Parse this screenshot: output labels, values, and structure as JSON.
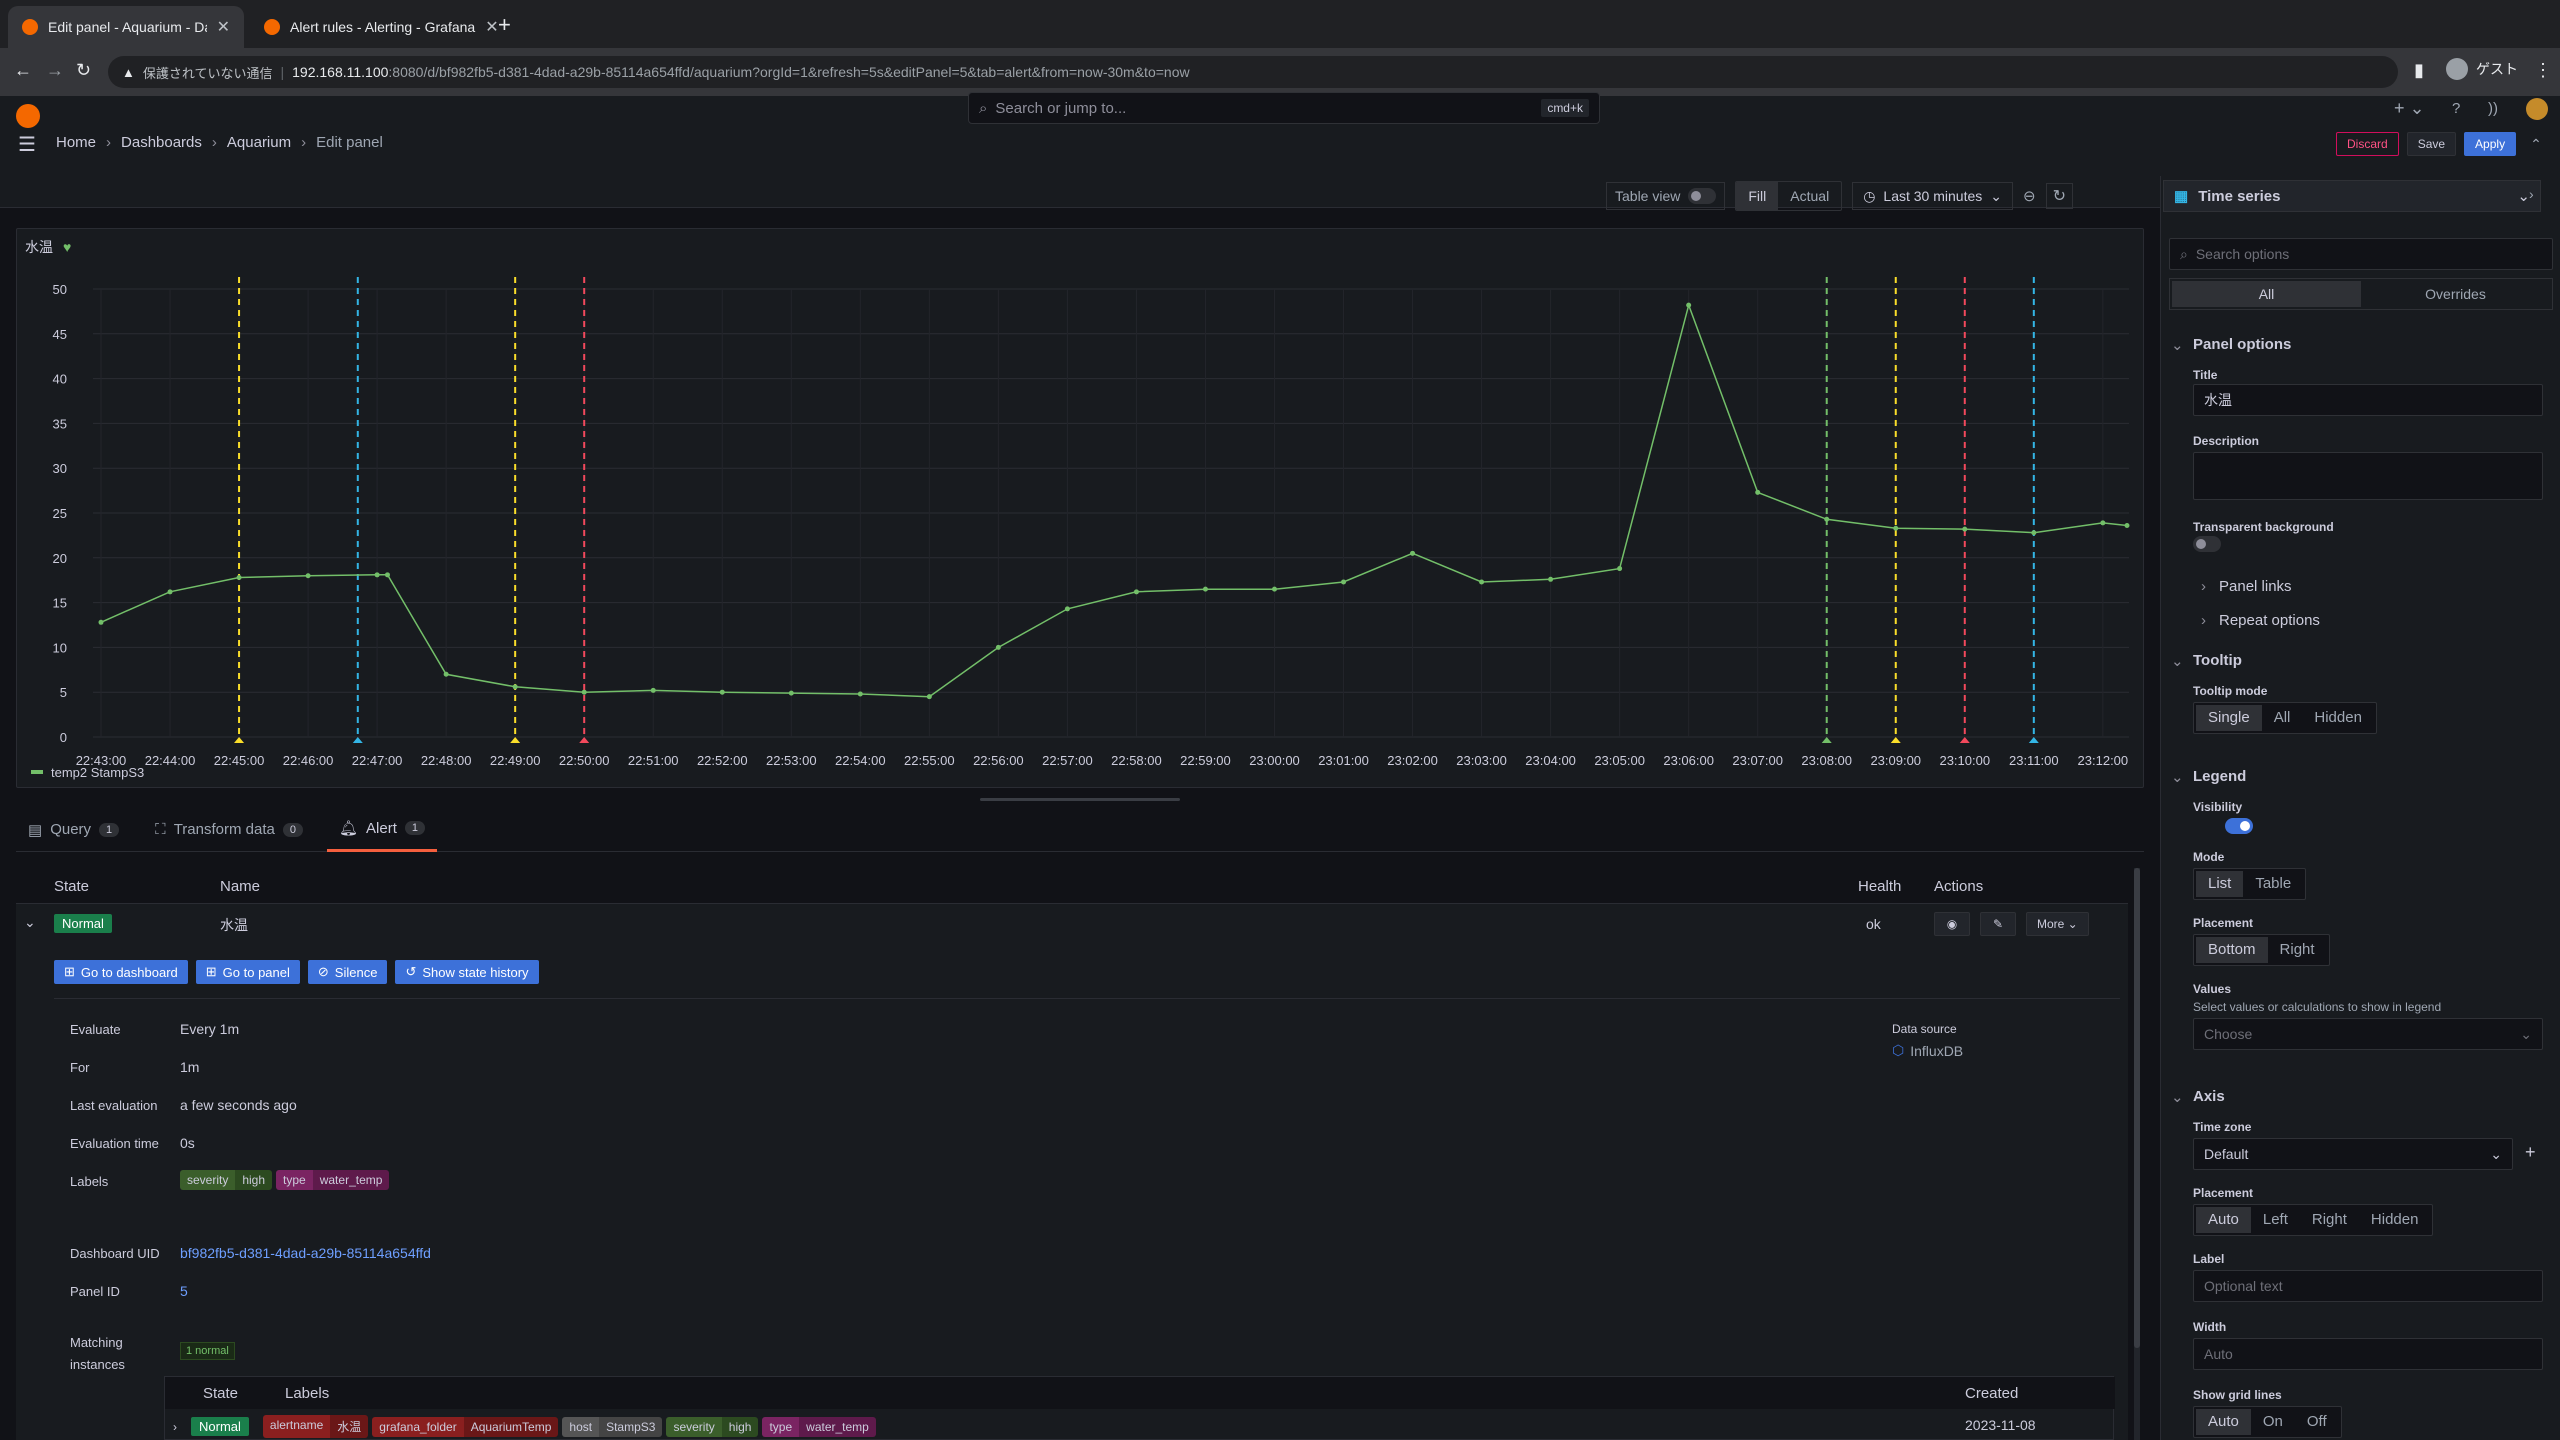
{
  "browser": {
    "tabs": [
      {
        "title": "Edit panel - Aquarium - Dashb",
        "active": true
      },
      {
        "title": "Alert rules - Alerting - Grafana",
        "active": false
      }
    ],
    "security": "保護されていない通信",
    "url_host": "192.168.11.100",
    "url_rest": ":8080/d/bf982fb5-d381-4dad-a29b-85114a654ffd/aquarium?orgId=1&refresh=5s&editPanel=5&tab=alert&from=now-30m&to=now",
    "profile": "ゲスト"
  },
  "header": {
    "search_placeholder": "Search or jump to...",
    "search_shortcut": "cmd+k",
    "breadcrumbs": [
      "Home",
      "Dashboards",
      "Aquarium",
      "Edit panel"
    ],
    "discard": "Discard",
    "save": "Save",
    "apply": "Apply"
  },
  "panel_toolbar": {
    "table_view": "Table view",
    "fill": "Fill",
    "actual": "Actual",
    "time_range": "Last 30 minutes"
  },
  "panel": {
    "title": "水温"
  },
  "chart_data": {
    "type": "line",
    "ylim": [
      0,
      50
    ],
    "yticks": [
      0,
      5,
      10,
      15,
      20,
      25,
      30,
      35,
      40,
      45,
      50
    ],
    "x": [
      "22:43:00",
      "22:44:00",
      "22:45:00",
      "22:46:00",
      "22:47:00",
      "22:48:00",
      "22:49:00",
      "22:50:00",
      "22:51:00",
      "22:52:00",
      "22:53:00",
      "22:54:00",
      "22:55:00",
      "22:56:00",
      "22:57:00",
      "22:58:00",
      "22:59:00",
      "23:00:00",
      "23:01:00",
      "23:02:00",
      "23:03:00",
      "23:04:00",
      "23:05:00",
      "23:06:00",
      "23:07:00",
      "23:08:00",
      "23:09:00",
      "23:10:00",
      "23:11:00",
      "23:12:00"
    ],
    "series": [
      {
        "name": "temp2 StampS3",
        "color": "#73bf69",
        "points": [
          [
            0,
            12.8
          ],
          [
            1,
            16.2
          ],
          [
            2,
            17.8
          ],
          [
            3,
            18.0
          ],
          [
            4,
            18.1
          ],
          [
            4.15,
            18.1
          ],
          [
            5,
            7.0
          ],
          [
            6,
            5.6
          ],
          [
            7,
            5.0
          ],
          [
            8,
            5.2
          ],
          [
            9,
            5.0
          ],
          [
            10,
            4.9
          ],
          [
            11,
            4.8
          ],
          [
            12,
            4.5
          ],
          [
            13,
            10.0
          ],
          [
            14,
            14.3
          ],
          [
            15,
            16.2
          ],
          [
            16,
            16.5
          ],
          [
            17,
            16.5
          ],
          [
            18,
            17.3
          ],
          [
            19,
            20.5
          ],
          [
            20,
            17.3
          ],
          [
            21,
            17.6
          ],
          [
            22,
            18.8
          ],
          [
            23,
            48.2
          ],
          [
            24,
            27.3
          ],
          [
            25,
            24.3
          ],
          [
            26,
            23.3
          ],
          [
            27,
            23.2
          ],
          [
            28,
            22.8
          ],
          [
            29,
            23.9
          ],
          [
            29.35,
            23.6
          ]
        ]
      }
    ],
    "annotations": [
      {
        "x": 2.0,
        "color": "#fade2a"
      },
      {
        "x": 3.72,
        "color": "#33b5e5"
      },
      {
        "x": 6.0,
        "color": "#fade2a"
      },
      {
        "x": 7.0,
        "color": "#f2495c"
      },
      {
        "x": 25.0,
        "color": "#73bf69"
      },
      {
        "x": 26.0,
        "color": "#fade2a"
      },
      {
        "x": 27.0,
        "color": "#f2495c"
      },
      {
        "x": 28.0,
        "color": "#33b5e5"
      }
    ],
    "legend": "bottom-left",
    "grid": true
  },
  "editor_tabs": [
    {
      "label": "Query",
      "count": "1",
      "icon": "database-icon"
    },
    {
      "label": "Transform data",
      "count": "0",
      "icon": "transform-icon"
    },
    {
      "label": "Alert",
      "count": "1",
      "icon": "bell-icon"
    }
  ],
  "alert": {
    "columns": {
      "state": "State",
      "name": "Name",
      "health": "Health",
      "actions": "Actions"
    },
    "rule": {
      "state": "Normal",
      "name": "水温",
      "health": "ok",
      "more": "More"
    },
    "buttons": [
      "Go to dashboard",
      "Go to panel",
      "Silence",
      "Show state history"
    ],
    "details": {
      "evaluate_k": "Evaluate",
      "evaluate_v": "Every 1m",
      "for_k": "For",
      "for_v": "1m",
      "last_eval_k": "Last evaluation",
      "last_eval_v": "a few seconds ago",
      "eval_time_k": "Evaluation time",
      "eval_time_v": "0s",
      "labels_k": "Labels",
      "uid_k": "Dashboard UID",
      "uid_v": "bf982fb5-d381-4dad-a29b-85114a654ffd",
      "panel_id_k": "Panel ID",
      "panel_id_v": "5",
      "matching_k": "Matching",
      "matching_k2": "instances",
      "matching_v": "1 normal",
      "datasource_k": "Data source",
      "datasource_v": "InfluxDB"
    },
    "labels": [
      {
        "key": "severity",
        "value": "high",
        "color": "#3b5e2b"
      },
      {
        "key": "type",
        "value": "water_temp",
        "color": "#7a2462"
      }
    ],
    "instances": {
      "cols": {
        "state": "State",
        "labels": "Labels",
        "created": "Created"
      },
      "row": {
        "state": "Normal",
        "created": "2023-11-08"
      },
      "labels": [
        {
          "key": "alertname",
          "value": "水温",
          "color": "#8a1f1f"
        },
        {
          "key": "grafana_folder",
          "value": "AquariumTemp",
          "color": "#8a1f1f"
        },
        {
          "key": "host",
          "value": "StampS3",
          "color": "#555"
        },
        {
          "key": "severity",
          "value": "high",
          "color": "#3b5e2b"
        },
        {
          "key": "type",
          "value": "water_temp",
          "color": "#7a2462"
        }
      ]
    }
  },
  "options": {
    "viz": "Time series",
    "search_placeholder": "Search options",
    "tab_all": "All",
    "tab_overrides": "Overrides",
    "panel_options": "Panel options",
    "title_label": "Title",
    "title_value": "水温",
    "description_label": "Description",
    "transparent_label": "Transparent background",
    "panel_links": "Panel links",
    "repeat_options": "Repeat options",
    "tooltip": "Tooltip",
    "tooltip_mode": "Tooltip mode",
    "tooltip_modes": [
      "Single",
      "All",
      "Hidden"
    ],
    "legend": "Legend",
    "visibility": "Visibility",
    "mode": "Mode",
    "modes": [
      "List",
      "Table"
    ],
    "placement": "Placement",
    "legend_placements": [
      "Bottom",
      "Right"
    ],
    "values": "Values",
    "values_sub": "Select values or calculations to show in legend",
    "values_choose": "Choose",
    "axis": "Axis",
    "time_zone": "Time zone",
    "time_zone_value": "Default",
    "axis_placement": "Placement",
    "axis_placements": [
      "Auto",
      "Left",
      "Right",
      "Hidden"
    ],
    "label": "Label",
    "label_placeholder": "Optional text",
    "width": "Width",
    "width_placeholder": "Auto",
    "grid_lines": "Show grid lines",
    "grid_options": [
      "Auto",
      "On",
      "Off"
    ]
  }
}
